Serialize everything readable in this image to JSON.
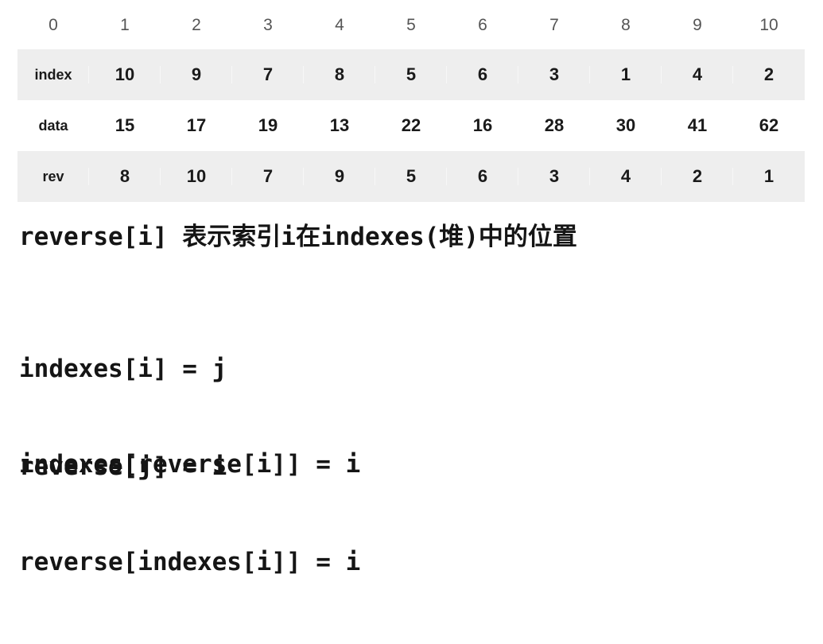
{
  "table": {
    "header": [
      "0",
      "1",
      "2",
      "3",
      "4",
      "5",
      "6",
      "7",
      "8",
      "9",
      "10"
    ],
    "rows": [
      {
        "label": "index",
        "values": [
          "10",
          "9",
          "7",
          "8",
          "5",
          "6",
          "3",
          "1",
          "4",
          "2"
        ]
      },
      {
        "label": "data",
        "values": [
          "15",
          "17",
          "19",
          "13",
          "22",
          "16",
          "28",
          "30",
          "41",
          "62"
        ]
      },
      {
        "label": "rev",
        "values": [
          "8",
          "10",
          "7",
          "9",
          "5",
          "6",
          "3",
          "4",
          "2",
          "1"
        ]
      }
    ]
  },
  "description": "reverse[i] 表示索引i在indexes(堆)中的位置",
  "assignments": [
    "indexes[i] = j",
    "reverse[j] = i"
  ],
  "inverse_identities": [
    "indexes[reverse[i]] = i",
    "reverse[indexes[i]] = i"
  ]
}
